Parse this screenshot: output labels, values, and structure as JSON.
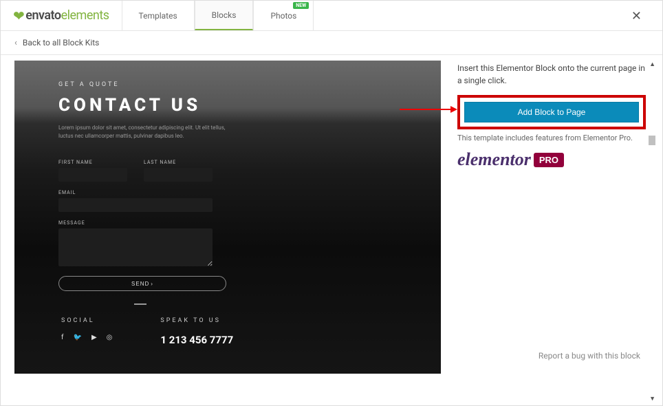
{
  "header": {
    "logo_prefix": "envato",
    "logo_suffix": "elements",
    "tabs": [
      {
        "label": "Templates",
        "badge": null
      },
      {
        "label": "Blocks",
        "badge": null
      },
      {
        "label": "Photos",
        "badge": "NEW"
      }
    ]
  },
  "back_link": "Back to all Block Kits",
  "preview": {
    "subtitle": "GET A QUOTE",
    "title": "CONTACT US",
    "lorem": "Lorem ipsum dolor sit amet, consectetur adipiscing elit. Ut elit tellus, luctus nec ullamcorper mattis, pulvinar dapibus leo.",
    "form": {
      "first_name_label": "FIRST NAME",
      "last_name_label": "LAST NAME",
      "email_label": "EMAIL",
      "message_label": "MESSAGE",
      "send_label": "SEND"
    },
    "footer": {
      "social_title": "SOCIAL",
      "speak_title": "SPEAK TO US",
      "phone": "1 213 456 7777"
    }
  },
  "side": {
    "intro": "Insert this Elementor Block onto the current page in a single click.",
    "add_button": "Add Block to Page",
    "pro_note": "This template includes features from Elementor Pro.",
    "elementor_text": "elementor",
    "pro_badge": "PRO",
    "bug_link": "Report a bug with this block"
  }
}
